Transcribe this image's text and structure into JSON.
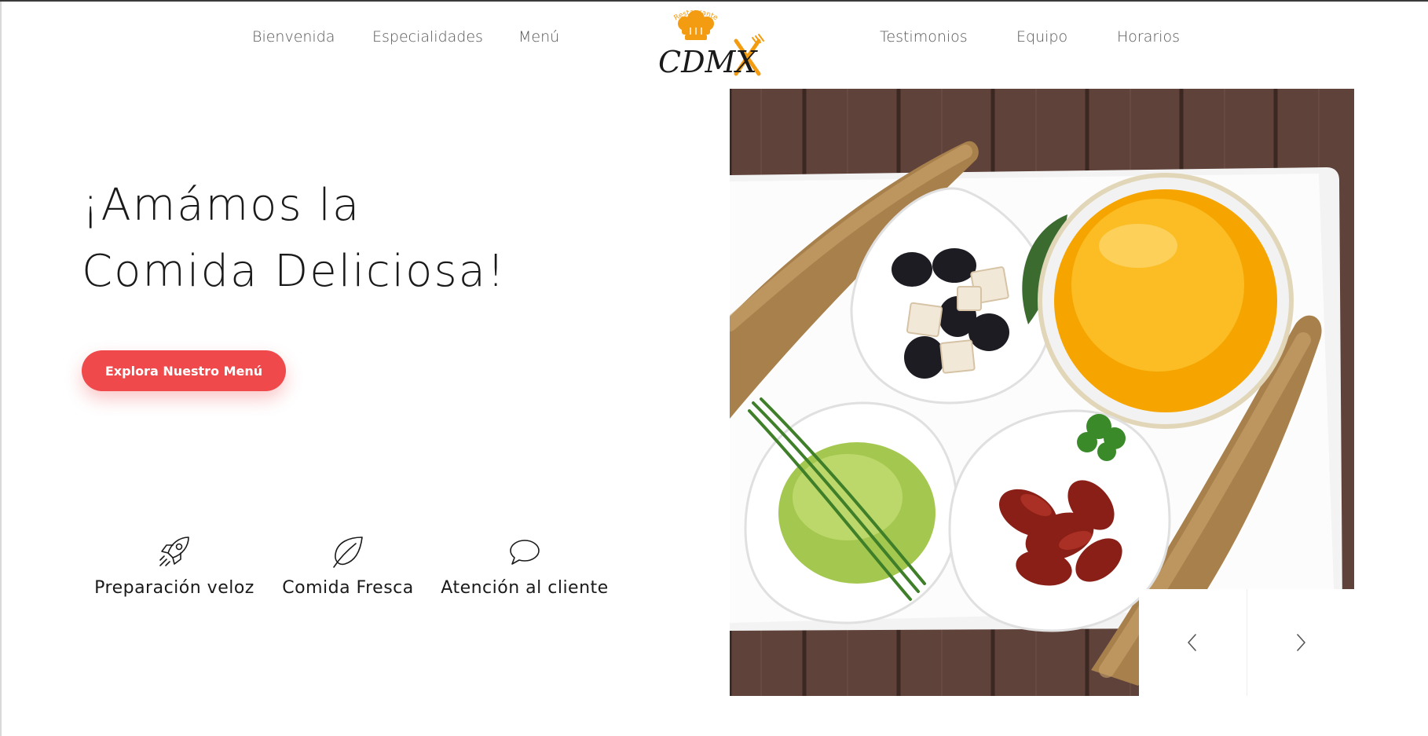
{
  "nav": {
    "left": [
      "Bienvenida",
      "Especialidades",
      "Menú"
    ],
    "right": [
      "Testimonios",
      "Equipo",
      "Horarios"
    ]
  },
  "logo": {
    "top_text": "Restaurante",
    "main_text": "CDMX",
    "color": "#f39c12"
  },
  "hero": {
    "title_line1": "¡Amámos la",
    "title_line2": "Comida Deliciosa!",
    "cta_label": "Explora Nuestro Menú",
    "cta_color": "#f0494b"
  },
  "features": [
    {
      "icon": "rocket-icon",
      "label": "Preparación veloz"
    },
    {
      "icon": "leaf-icon",
      "label": "Comida Fresca"
    },
    {
      "icon": "chat-bubble-icon",
      "label": "Atención al cliente"
    }
  ],
  "slider": {
    "prev_icon": "chevron-left-icon",
    "next_icon": "chevron-right-icon"
  }
}
